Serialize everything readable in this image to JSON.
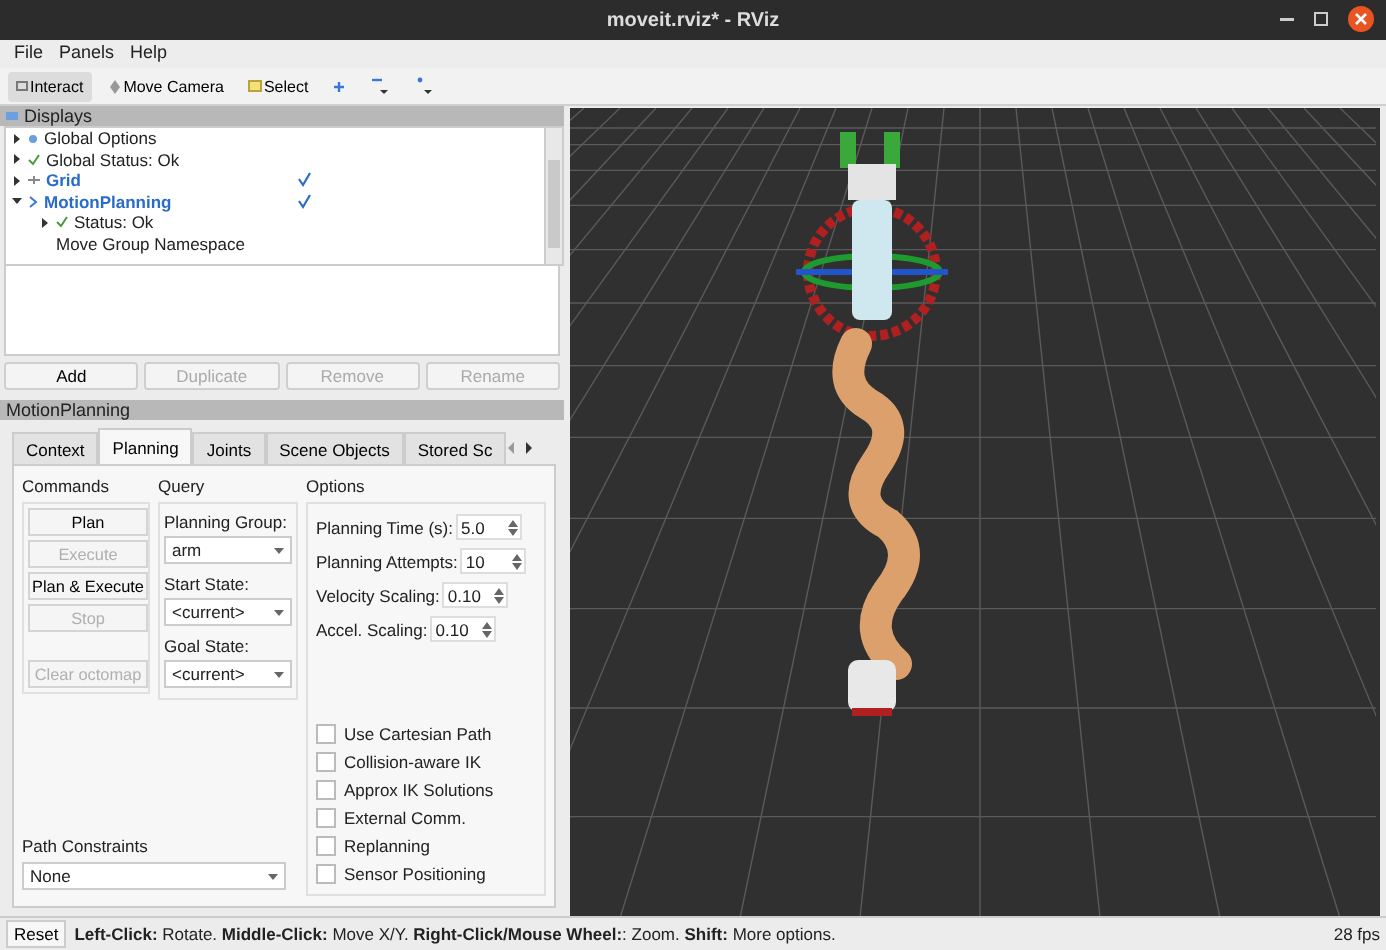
{
  "window": {
    "title": "moveit.rviz* - RViz"
  },
  "menu": [
    "File",
    "Panels",
    "Help"
  ],
  "toolbar": [
    {
      "label": "Interact",
      "kind": "interact",
      "selected": true
    },
    {
      "label": "Move Camera",
      "kind": "camera",
      "selected": false
    },
    {
      "label": "Select",
      "kind": "select",
      "selected": false
    },
    {
      "kind": "plus",
      "selected": false
    },
    {
      "kind": "minus",
      "selected": false
    },
    {
      "kind": "dot",
      "selected": false
    }
  ],
  "displays": {
    "title": "Displays",
    "tree": [
      {
        "label": "Global Options",
        "kind": "options",
        "link": false,
        "expanded": false
      },
      {
        "label": "Global Status: Ok",
        "kind": "ok",
        "link": false,
        "expanded": false
      },
      {
        "label": "Grid",
        "kind": "grid",
        "link": true,
        "checked": true,
        "expanded": false
      },
      {
        "label": "MotionPlanning",
        "kind": "plugin",
        "link": true,
        "checked": true,
        "expanded": true,
        "children": [
          {
            "label": "Status: Ok",
            "kind": "ok",
            "link": false,
            "expanded": false
          },
          {
            "label": "Move Group Namespace",
            "kind": "none",
            "link": false
          }
        ]
      }
    ],
    "buttons": [
      {
        "label": "Add",
        "disabled": false
      },
      {
        "label": "Duplicate",
        "disabled": true
      },
      {
        "label": "Remove",
        "disabled": true
      },
      {
        "label": "Rename",
        "disabled": true
      }
    ]
  },
  "motion_planning": {
    "title": "MotionPlanning",
    "tabs": [
      {
        "label": "Context",
        "selected": false
      },
      {
        "label": "Planning",
        "selected": true
      },
      {
        "label": "Joints",
        "selected": false
      },
      {
        "label": "Scene Objects",
        "selected": false
      },
      {
        "label": "Stored Sc",
        "selected": false
      }
    ],
    "commands": {
      "title": "Commands",
      "buttons": [
        {
          "label": "Plan",
          "disabled": false
        },
        {
          "label": "Execute",
          "disabled": true
        },
        {
          "label": "Plan & Execute",
          "disabled": false
        },
        {
          "label": "Stop",
          "disabled": true
        },
        {
          "label": "Clear octomap",
          "disabled": true
        }
      ]
    },
    "query": {
      "title": "Query",
      "fields": [
        {
          "label": "Planning Group:",
          "value": "arm"
        },
        {
          "label": "Start State:",
          "value": "<current>"
        },
        {
          "label": "Goal State:",
          "value": "<current>"
        }
      ]
    },
    "options": {
      "title": "Options",
      "spinners": [
        {
          "label": "Planning Time (s):",
          "value": "5.0"
        },
        {
          "label": "Planning Attempts:",
          "value": "10"
        },
        {
          "label": "Velocity Scaling:",
          "value": "0.10"
        },
        {
          "label": "Accel. Scaling:",
          "value": "0.10"
        }
      ],
      "checkboxes": [
        {
          "label": "Use Cartesian Path",
          "checked": false
        },
        {
          "label": "Collision-aware IK",
          "checked": false
        },
        {
          "label": "Approx IK Solutions",
          "checked": false
        },
        {
          "label": "External Comm.",
          "checked": false
        },
        {
          "label": "Replanning",
          "checked": false
        },
        {
          "label": "Sensor Positioning",
          "checked": false
        }
      ]
    },
    "path_constraints": {
      "label": "Path Constraints",
      "value": "None"
    }
  },
  "status_bar": {
    "button": "Reset",
    "hint": "**Left-Click:** Rotate. **Middle-Click:** Move X/Y. **Right-Click/Mouse Wheel:**: Zoom. **Shift:** More options.",
    "fps": "28 fps"
  }
}
